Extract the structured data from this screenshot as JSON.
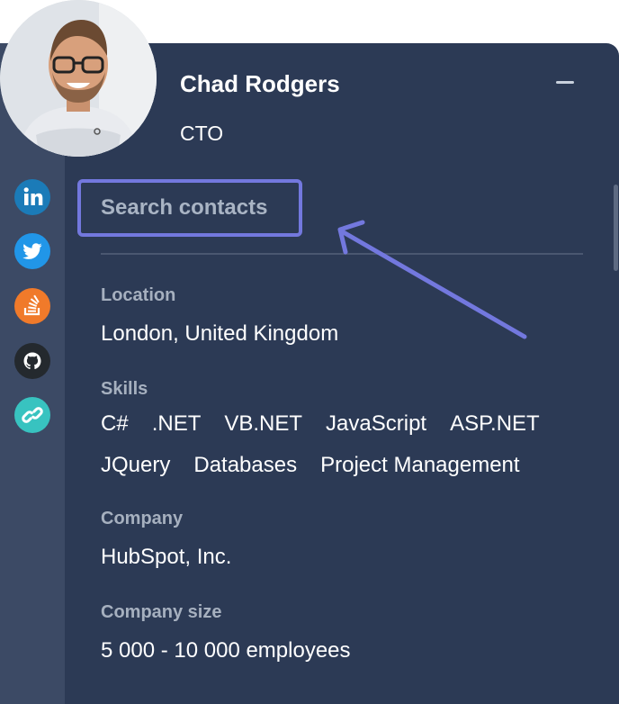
{
  "profile": {
    "name": "Chad Rodgers",
    "title": "CTO",
    "avatar_icon": "person-photo"
  },
  "header": {
    "collapse_icon": "minus-icon"
  },
  "social_links": [
    {
      "name": "linkedin",
      "icon": "linkedin-icon",
      "color": "#1b7bb8"
    },
    {
      "name": "twitter",
      "icon": "twitter-icon",
      "color": "#2196e8"
    },
    {
      "name": "stackoverflow",
      "icon": "stackoverflow-icon",
      "color": "#f07a2a"
    },
    {
      "name": "github",
      "icon": "github-icon",
      "color": "#24292e"
    },
    {
      "name": "website",
      "icon": "link-icon",
      "color": "#38c3c0"
    }
  ],
  "search": {
    "label": "Search contacts"
  },
  "location": {
    "label": "Location",
    "value": "London, United Kingdom"
  },
  "skills": {
    "label": "Skills",
    "items": [
      "C#",
      ".NET",
      "VB.NET",
      "JavaScript",
      "ASP.NET",
      "JQuery",
      "Databases",
      "Project Management"
    ]
  },
  "company": {
    "label": "Company",
    "value": "HubSpot, Inc."
  },
  "company_size": {
    "label": "Company size",
    "value": "5 000 - 10 000 employees"
  },
  "colors": {
    "panel": "#2c3a55",
    "rail": "#3c4a65",
    "highlight": "#7378de"
  }
}
